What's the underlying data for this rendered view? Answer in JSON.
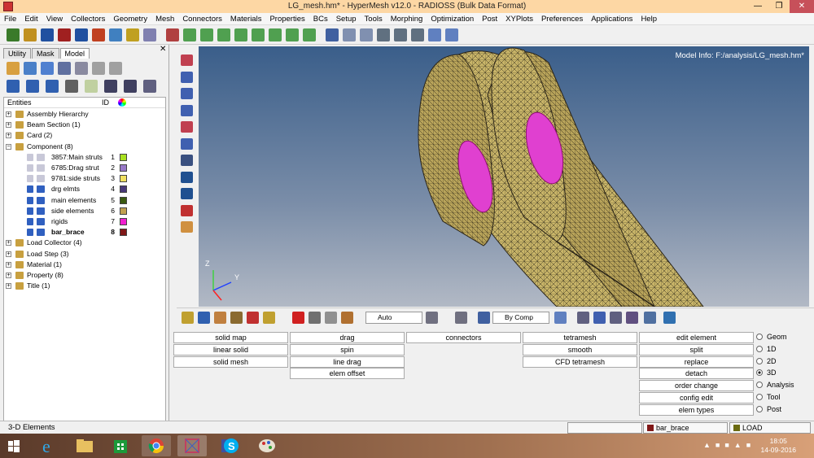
{
  "title": "LG_mesh.hm* - HyperMesh v12.0 - RADIOSS (Bulk Data Format)",
  "menu": [
    "File",
    "Edit",
    "View",
    "Collectors",
    "Geometry",
    "Mesh",
    "Connectors",
    "Materials",
    "Properties",
    "BCs",
    "Setup",
    "Tools",
    "Morphing",
    "Optimization",
    "Post",
    "XYPlots",
    "Preferences",
    "Applications",
    "Help"
  ],
  "tabs": [
    "Utility",
    "Mask",
    "Model"
  ],
  "tree_header": {
    "name": "Entities",
    "id": "ID"
  },
  "tree": [
    {
      "label": "Assembly Hierarchy",
      "id": "",
      "indent": 0,
      "color": "#c8a040"
    },
    {
      "label": "Beam Section (1)",
      "id": "",
      "indent": 0,
      "color": "#c8a040"
    },
    {
      "label": "Card (2)",
      "id": "",
      "indent": 0,
      "color": "#c8a040"
    },
    {
      "label": "Component (8)",
      "id": "",
      "indent": 0,
      "color": "#c8a040",
      "open": true
    },
    {
      "label": "3857:Main struts",
      "id": "1",
      "indent": 2,
      "color": "#c8c8d8",
      "swatch": "#a8e020"
    },
    {
      "label": "6785:Drag strut",
      "id": "2",
      "indent": 2,
      "color": "#c8c8d8",
      "swatch": "#9878c8"
    },
    {
      "label": "9781:side struts",
      "id": "3",
      "indent": 2,
      "color": "#c8c8d8",
      "swatch": "#f0e060"
    },
    {
      "label": "drg elmts",
      "id": "4",
      "indent": 2,
      "color": "#3060c0",
      "swatch": "#483878"
    },
    {
      "label": "main elements",
      "id": "5",
      "indent": 2,
      "color": "#3060c0",
      "swatch": "#3a5a10"
    },
    {
      "label": "side elements",
      "id": "6",
      "indent": 2,
      "color": "#3060c0",
      "swatch": "#c0a050"
    },
    {
      "label": "rigids",
      "id": "7",
      "indent": 2,
      "color": "#3060c0",
      "swatch": "#f020d0"
    },
    {
      "label": "bar_brace",
      "id": "8",
      "indent": 2,
      "color": "#3060c0",
      "swatch": "#801818",
      "bold": true
    },
    {
      "label": "Load Collector (4)",
      "id": "",
      "indent": 0,
      "color": "#c8a040"
    },
    {
      "label": "Load Step (3)",
      "id": "",
      "indent": 0,
      "color": "#c8a040"
    },
    {
      "label": "Material (1)",
      "id": "",
      "indent": 0,
      "color": "#c8a040"
    },
    {
      "label": "Property (8)",
      "id": "",
      "indent": 0,
      "color": "#c8a040"
    },
    {
      "label": "Title (1)",
      "id": "",
      "indent": 0,
      "color": "#c8a040"
    }
  ],
  "model_info": "Model Info: F:/analysis/LG_mesh.hm*",
  "axes": {
    "z": "Z",
    "y": "Y"
  },
  "combos": {
    "auto": "Auto",
    "bycomp": "By Comp"
  },
  "panel": {
    "col1": [
      "solid map",
      "linear solid",
      "solid mesh"
    ],
    "col2": [
      "drag",
      "spin",
      "line drag",
      "elem offset"
    ],
    "col3": [
      "connectors"
    ],
    "col4": [
      "tetramesh",
      "smooth",
      "CFD tetramesh"
    ],
    "col5": [
      "edit element",
      "split",
      "replace",
      "detach",
      "order change",
      "config edit",
      "elem types"
    ]
  },
  "radios": [
    {
      "label": "Geom",
      "on": false
    },
    {
      "label": "1D",
      "on": false
    },
    {
      "label": "2D",
      "on": false
    },
    {
      "label": "3D",
      "on": true
    },
    {
      "label": "Analysis",
      "on": false
    },
    {
      "label": "Tool",
      "on": false
    },
    {
      "label": "Post",
      "on": false
    }
  ],
  "status": {
    "left": "3-D Elements",
    "comp": "bar_brace",
    "comp_color": "#801818",
    "load": "LOAD",
    "load_color": "#6a6a10"
  },
  "clock": {
    "time": "18:05",
    "date": "14-09-2016"
  }
}
